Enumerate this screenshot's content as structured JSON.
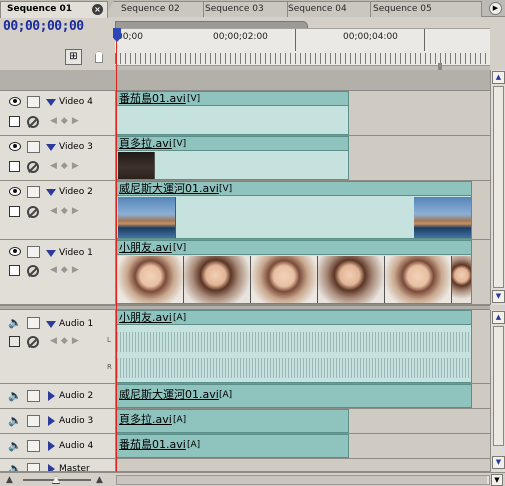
{
  "tabs": [
    {
      "label": "Sequence 01",
      "active": true
    },
    {
      "label": "Sequence 02",
      "active": false
    },
    {
      "label": "Sequence 03",
      "active": false
    },
    {
      "label": "Sequence 04",
      "active": false
    },
    {
      "label": "Sequence 05",
      "active": false
    }
  ],
  "tab_close": "×",
  "panel_menu": "▶",
  "timecode": "00;00;00;00",
  "ruler": {
    "labels": [
      "00;00",
      "00;00;02:00",
      "00;00;04:00"
    ]
  },
  "tracks": {
    "video4": {
      "name": "Video 4"
    },
    "video3": {
      "name": "Video 3"
    },
    "video2": {
      "name": "Video 2"
    },
    "video1": {
      "name": "Video 1"
    },
    "audio1": {
      "name": "Audio 1",
      "lr_left": "L",
      "lr_right": "R"
    },
    "audio2": {
      "name": "Audio 2"
    },
    "audio3": {
      "name": "Audio 3"
    },
    "audio4": {
      "name": "Audio 4"
    },
    "master": {
      "name": "Master"
    }
  },
  "clips": {
    "v4": {
      "name": "番茄島01.avi",
      "tag": "[V]"
    },
    "v3": {
      "name": "頁多拉.avi",
      "tag": "[V]"
    },
    "v2": {
      "name": "威尼斯大運河01.avi",
      "tag": "[V]"
    },
    "v1": {
      "name": "小朋友.avi",
      "tag": "[V]"
    },
    "a1": {
      "name": "小朋友.avi",
      "tag": "[A]"
    },
    "a2": {
      "name": "威尼斯大運河01.avi",
      "tag": "[A]"
    },
    "a3": {
      "name": "頁多拉.avi",
      "tag": "[A]"
    },
    "a4": {
      "name": "番茄島01.avi",
      "tag": "[A]"
    }
  },
  "colors": {
    "clip_fill": "#a9d3cf",
    "clip_header": "#8fc3be",
    "playhead": "#e2231a",
    "timecode": "#1b2a9c"
  },
  "icons": {
    "snap": "snap-icon",
    "marker": "marker-icon",
    "eye": "eye-icon",
    "speaker": "speaker-icon",
    "lock": "lock-icon",
    "collapse": "triangle-icon"
  }
}
